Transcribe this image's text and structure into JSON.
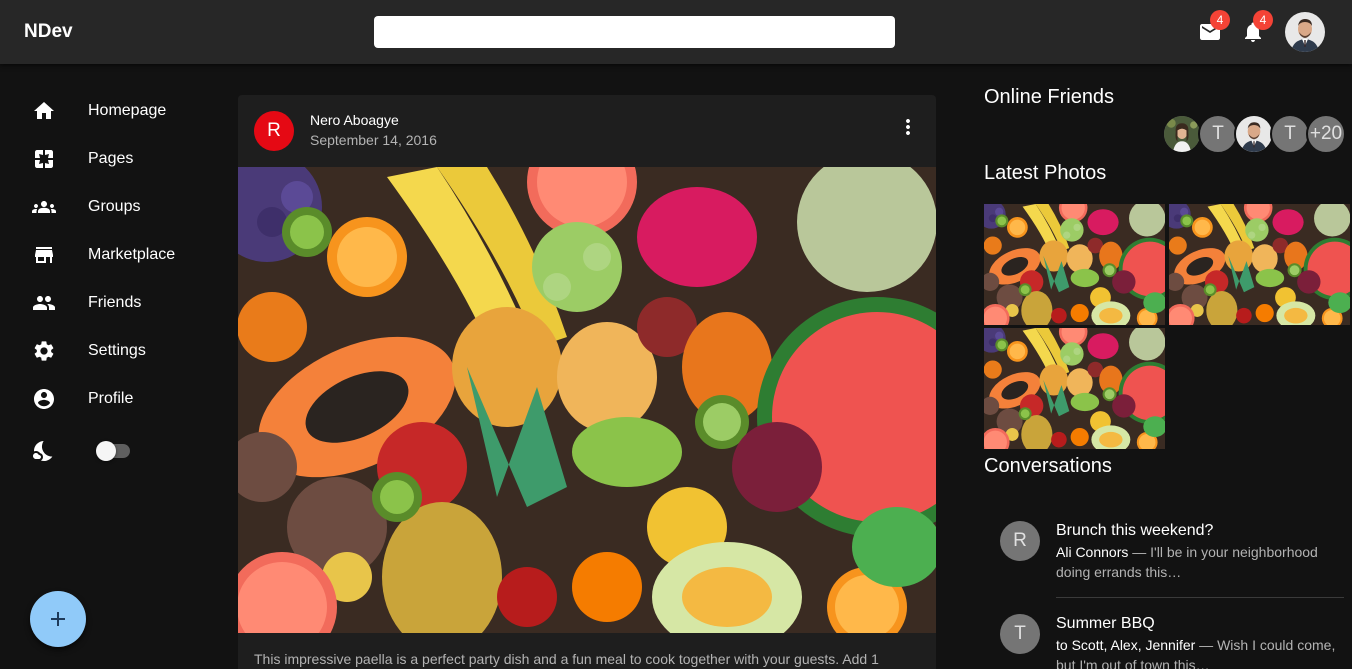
{
  "app": {
    "brand": "NDev"
  },
  "search": {
    "placeholder": "",
    "value": ""
  },
  "header": {
    "mail_count": "4",
    "notification_count": "4"
  },
  "sidebar": {
    "items": [
      {
        "label": "Homepage",
        "icon": "home-icon"
      },
      {
        "label": "Pages",
        "icon": "pages-icon"
      },
      {
        "label": "Groups",
        "icon": "groups-icon"
      },
      {
        "label": "Marketplace",
        "icon": "storefront-icon"
      },
      {
        "label": "Friends",
        "icon": "people-icon"
      },
      {
        "label": "Settings",
        "icon": "gear-icon"
      },
      {
        "label": "Profile",
        "icon": "account-circle-icon"
      }
    ],
    "dark_mode_icon": "night-mode-icon",
    "dark_mode_on": false,
    "fab_label": "+"
  },
  "post": {
    "avatar_initial": "R",
    "author": "Nero Aboagye",
    "date": "September 14, 2016",
    "image": "fruit-assortment-photo",
    "text": "This impressive paella is a perfect party dish and a fun meal to cook together with your guests. Add 1"
  },
  "right": {
    "online_friends_title": "Online Friends",
    "online_friends": [
      {
        "type": "photo",
        "label": ""
      },
      {
        "type": "initial",
        "label": "T"
      },
      {
        "type": "photo",
        "label": ""
      },
      {
        "type": "initial",
        "label": "T"
      },
      {
        "type": "more",
        "label": "+20"
      }
    ],
    "latest_photos_title": "Latest Photos",
    "latest_photos": [
      "fruit-assortment-photo",
      "fruit-assortment-photo",
      "fruit-assortment-photo"
    ],
    "conversations_title": "Conversations",
    "conversations": [
      {
        "initial": "R",
        "title": "Brunch this weekend?",
        "who": "Ali Connors",
        "snippet": " — I'll be in your neighborhood doing errands this…"
      },
      {
        "initial": "T",
        "title": "Summer BBQ",
        "who": "to Scott, Alex, Jennifer",
        "snippet": " — Wish I could come, but I'm out of town this…"
      }
    ]
  },
  "colors": {
    "background": "#121212",
    "appbar": "#272727",
    "card": "#1e1e1e",
    "fab": "#90caf9",
    "badge": "#f44336",
    "post_avatar": "#e50914"
  }
}
